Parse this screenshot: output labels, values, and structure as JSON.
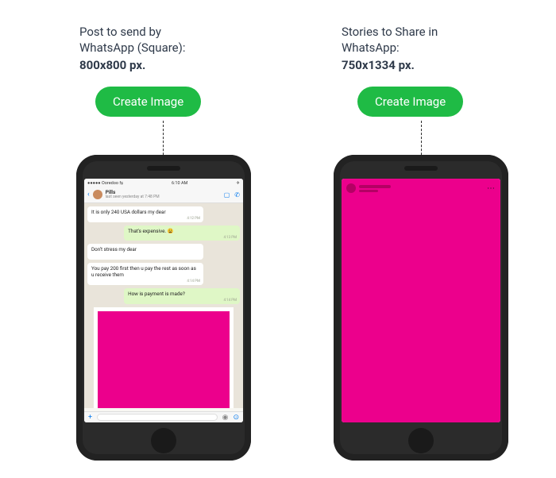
{
  "left": {
    "title_line1": "Post to send by",
    "title_line2": "WhatsApp (Square):",
    "dims": "800x800 px.",
    "cta": "Create Image",
    "status": {
      "carrier": "●●●●● Ooredoo",
      "signal": "⇆",
      "time": "6:10 AM",
      "right": "✈"
    },
    "chat": {
      "name": "Pills",
      "seen": "last seen yesterday at 7:48 PM",
      "messages": [
        {
          "side": "left",
          "text": "It is only 240 USA dollars my dear",
          "time": "4:12 PM"
        },
        {
          "side": "right",
          "text": "That's expensive. 😩",
          "time": "4:13 PM"
        },
        {
          "side": "left",
          "text": "Don't stress my dear",
          "time": ""
        },
        {
          "side": "left",
          "text": "You pay 200 first then u pay the rest as soon as u receive them",
          "time": "4:14 PM"
        },
        {
          "side": "right",
          "text": "How is payment is made?",
          "time": "4:14 PM"
        }
      ]
    }
  },
  "right": {
    "title_line1": "Stories to Share in",
    "title_line2": "WhatsApp:",
    "dims": "750x1334 px.",
    "cta": "Create Image"
  },
  "colors": {
    "cta": "#1fbb45",
    "highlight": "#ec008c"
  }
}
